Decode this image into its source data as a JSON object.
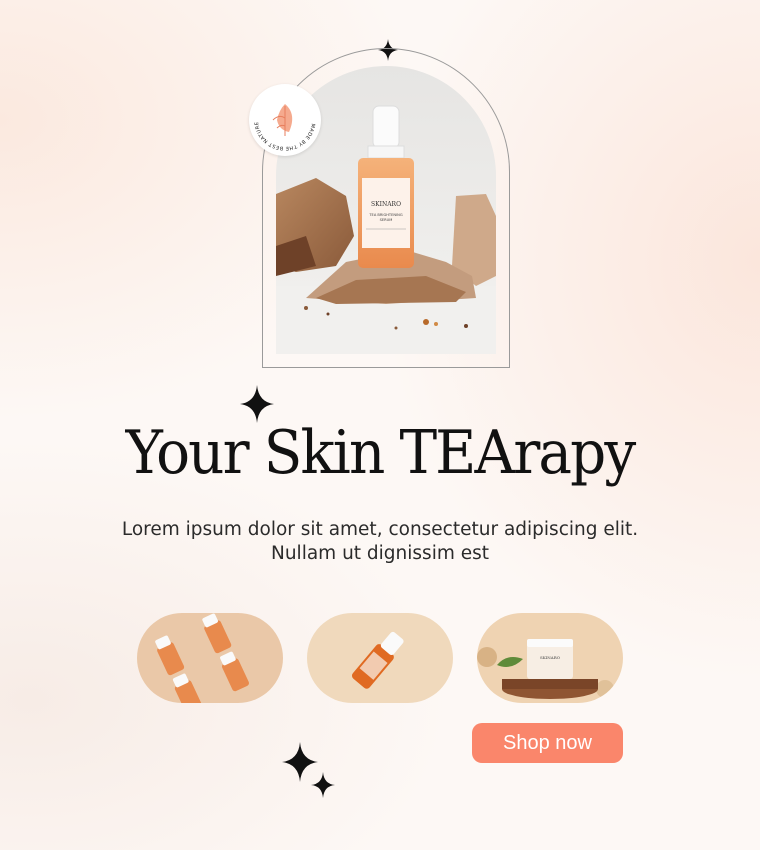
{
  "hero": {
    "badge_text": "MADE BY THE BEST NATURE INGREDIENTS",
    "bottle_brand": "SKINARO",
    "bottle_product": "TEA BRIGHTENING SERUM",
    "bottle_image_name": "serum-bottle-on-rocks-photo"
  },
  "headline": "Your Skin TEArapy",
  "subtitle": "Lorem ipsum dolor sit amet, consectetur adipiscing elit. Nullam ut dignissim est",
  "gallery": [
    {
      "name": "four-serum-bottles-photo"
    },
    {
      "name": "single-serum-bottle-photo"
    },
    {
      "name": "cream-jar-photo"
    }
  ],
  "cta": {
    "label": "Shop now",
    "color": "#fa866b"
  },
  "colors": {
    "accent": "#fa866b",
    "text": "#111111",
    "background": "#fdf8f5"
  }
}
